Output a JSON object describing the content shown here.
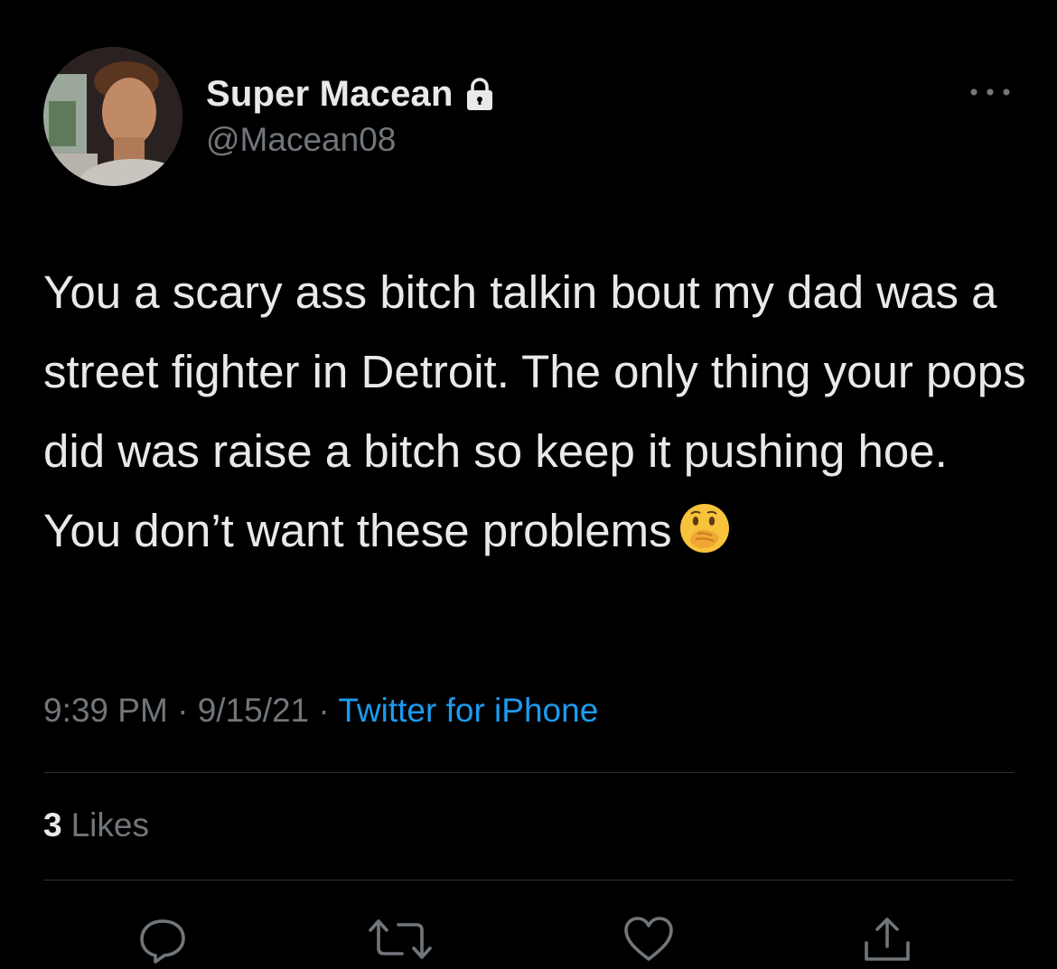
{
  "user": {
    "display_name": "Super Macean",
    "handle": "@Macean08",
    "protected_icon": "lock-icon",
    "avatar": "profile-photo"
  },
  "tweet": {
    "text": "You a scary ass bitch talkin bout my dad was a street fighter in Detroit. The only thing your pops did was raise a bitch so keep it pushing hoe. You don’t want these problems",
    "emoji": "face-with-hand-over-mouth",
    "time": "9:39 PM",
    "separator": " · ",
    "date": "9/15/21",
    "source": "Twitter for iPhone"
  },
  "stats": {
    "likes_count": "3",
    "likes_label": "Likes"
  },
  "actions": [
    "reply-icon",
    "retweet-icon",
    "like-icon",
    "share-icon"
  ],
  "colors": {
    "background": "#000000",
    "text": "#e7e9ea",
    "secondary": "#71767b",
    "link": "#1d9bf0",
    "divider": "#2f3336"
  }
}
